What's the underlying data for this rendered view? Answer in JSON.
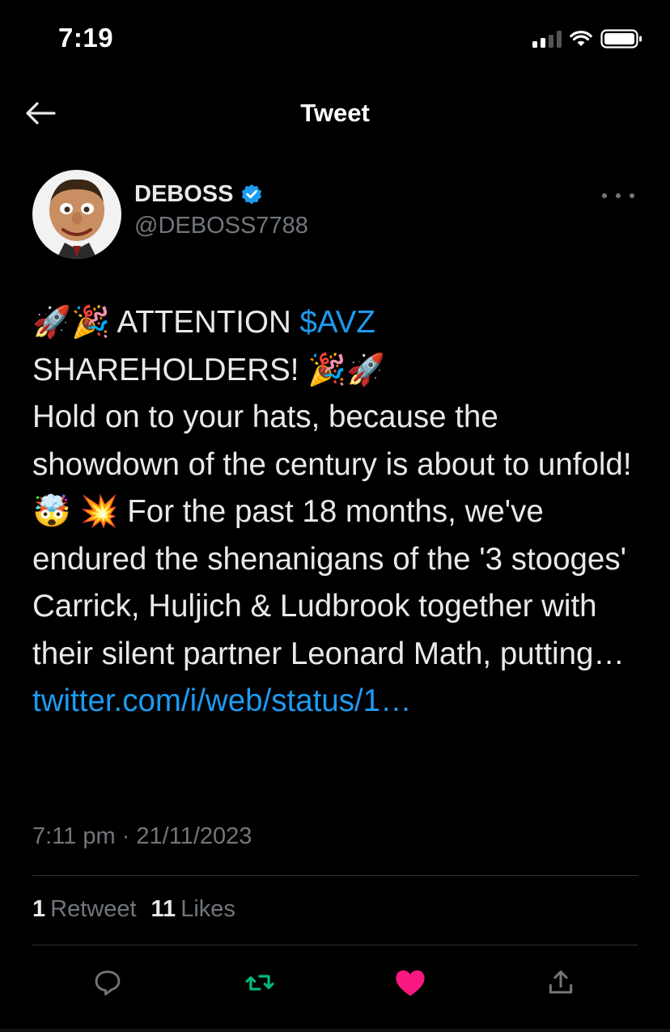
{
  "status_bar": {
    "time": "7:19"
  },
  "header": {
    "title": "Tweet"
  },
  "tweet": {
    "display_name": "DEBOSS",
    "handle": "@DEBOSS7788",
    "emoji_rocket": "🚀",
    "emoji_party": "🎉",
    "emoji_mindblown": "🤯",
    "emoji_collision": "💥",
    "attention_text": " ATTENTION ",
    "cashtag": "$AVZ",
    "shareholders_text": "SHAREHOLDERS! ",
    "body_part1": "Hold on to your hats, because the showdown of the century is about to unfold! ",
    "body_part2": " For the past 18 months, we've endured the shenanigans of the '3 stooges' Carrick, Huljich & Ludbrook together with their silent partner Leonard Math, putting…",
    "link": "twitter.com/i/web/status/1…",
    "timestamp": "7:11 pm · 21/11/2023",
    "retweet_count": "1",
    "retweet_label": "Retweet",
    "like_count": "11",
    "like_label": "Likes"
  },
  "colors": {
    "background": "#000000",
    "text": "#e7e9ea",
    "secondary": "#71767b",
    "link": "#1d9bf0",
    "retweet_green": "#00ba7c",
    "like_pink": "#f91880",
    "verified_blue": "#1d9bf0"
  },
  "icons": [
    "back-arrow-icon",
    "verified-badge-icon",
    "more-icon",
    "reply-icon",
    "retweet-icon",
    "like-icon",
    "share-icon"
  ]
}
